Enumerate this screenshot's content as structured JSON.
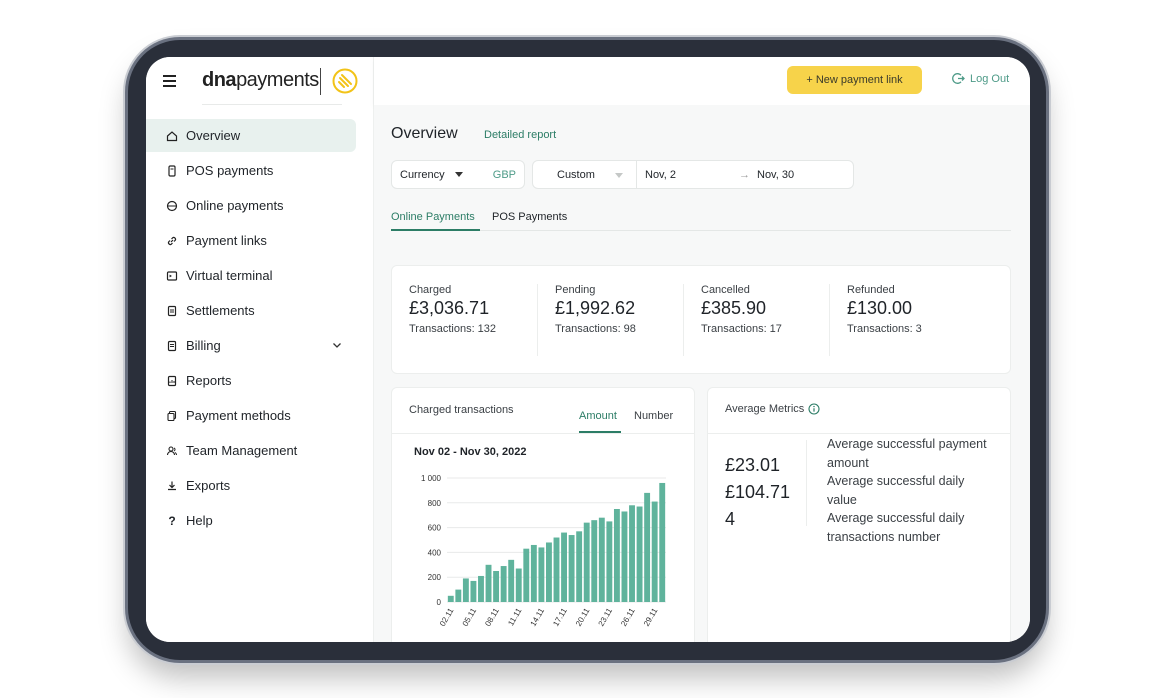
{
  "brand": {
    "name_bold": "dna",
    "name_light": "payments"
  },
  "colors": {
    "accent": "#2c7d66",
    "button": "#f7d34a",
    "bar": "#5fb39c",
    "active_bg": "#e8f1ee"
  },
  "sidebar": {
    "items": [
      {
        "label": "Overview",
        "icon": "home-icon"
      },
      {
        "label": "POS payments",
        "icon": "pos-terminal-icon"
      },
      {
        "label": "Online payments",
        "icon": "globe-icon"
      },
      {
        "label": "Payment links",
        "icon": "link-icon"
      },
      {
        "label": "Virtual terminal",
        "icon": "terminal-icon"
      },
      {
        "label": "Settlements",
        "icon": "document-icon"
      },
      {
        "label": "Billing",
        "icon": "invoice-icon"
      },
      {
        "label": "Reports",
        "icon": "report-icon"
      },
      {
        "label": "Payment methods",
        "icon": "cards-icon"
      },
      {
        "label": "Team Management",
        "icon": "team-icon"
      },
      {
        "label": "Exports",
        "icon": "download-icon"
      },
      {
        "label": "Help",
        "icon": "question-icon"
      }
    ]
  },
  "topbar": {
    "new_link": "+ New payment link",
    "logout": "Log Out"
  },
  "page": {
    "title": "Overview",
    "detail_link": "Detailed report"
  },
  "filters": {
    "currency_label": "Currency",
    "currency_value": "GBP",
    "range": "Custom",
    "date_from": "Nov, 2",
    "date_arrow": "→",
    "date_to": "Nov, 30"
  },
  "tabs": [
    "Online Payments",
    "POS Payments"
  ],
  "stats": [
    {
      "label": "Charged",
      "value": "£3,036.71",
      "transactions": "Transactions: 132"
    },
    {
      "label": "Pending",
      "value": "£1,992.62",
      "transactions": "Transactions: 98"
    },
    {
      "label": "Cancelled",
      "value": "£385.90",
      "transactions": "Transactions: 17"
    },
    {
      "label": "Refunded",
      "value": "£130.00",
      "transactions": "Transactions: 3"
    }
  ],
  "charged_card": {
    "title": "Charged transactions",
    "toggle_amount": "Amount",
    "toggle_number": "Number",
    "chart_title": "Nov 02 - Nov 30, 2022"
  },
  "avg_card": {
    "title": "Average Metrics",
    "values": [
      "£23.01",
      "£104.71",
      "4"
    ],
    "labels": [
      "Average successful payment amount",
      "Average successful daily value",
      "Average successful daily transactions number"
    ]
  },
  "chart_data": {
    "type": "bar",
    "title": "Nov 02 - Nov 30, 2022",
    "xlabel": "",
    "ylabel": "",
    "ylim": [
      0,
      1000
    ],
    "y_ticks": [
      "0",
      "200",
      "400",
      "600",
      "800",
      "1 000"
    ],
    "y_tick_values": [
      0,
      200,
      400,
      600,
      800,
      1000
    ],
    "categories": [
      "02.11",
      "03.11",
      "04.11",
      "05.11",
      "06.11",
      "07.11",
      "08.11",
      "09.11",
      "10.11",
      "11.11",
      "12.11",
      "13.11",
      "14.11",
      "15.11",
      "16.11",
      "17.11",
      "18.11",
      "19.11",
      "20.11",
      "21.11",
      "22.11",
      "23.11",
      "24.11",
      "25.11",
      "26.11",
      "27.11",
      "28.11",
      "29.11",
      "30.11"
    ],
    "tick_labels": [
      "02.11",
      "05.11",
      "08.11",
      "11.11",
      "14.11",
      "17.11",
      "20.11",
      "23.11",
      "26.11",
      "29.11"
    ],
    "values": [
      50,
      100,
      190,
      170,
      210,
      300,
      250,
      290,
      340,
      270,
      430,
      460,
      440,
      480,
      520,
      560,
      540,
      570,
      640,
      660,
      680,
      650,
      750,
      730,
      780,
      770,
      880,
      810,
      960
    ]
  }
}
